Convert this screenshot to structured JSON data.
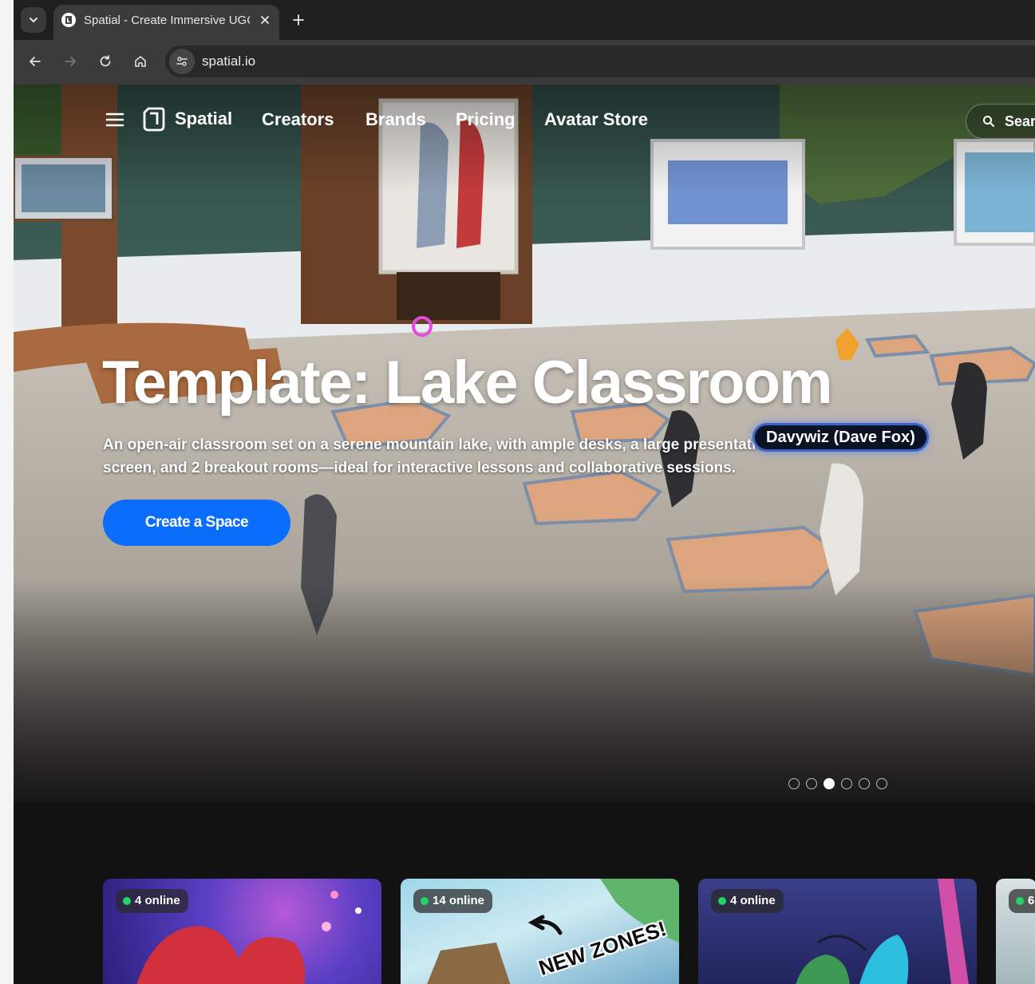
{
  "browser": {
    "tab_title": "Spatial - Create Immersive UGC",
    "url": "spatial.io",
    "colors": {
      "frame": "#1f1f1f",
      "toolbar": "#3b3b3b"
    }
  },
  "nav": {
    "brand": "Spatial",
    "links": [
      "Creators",
      "Brands",
      "Pricing",
      "Avatar Store"
    ],
    "search_placeholder": "Sear"
  },
  "hero": {
    "title": "Template: Lake Classroom",
    "description": "An open-air classroom set on a serene mountain lake, with ample desks, a large presentation screen, and 2 breakout rooms—ideal for interactive lessons and collaborative sessions.",
    "cta_label": "Create a Space",
    "avatar_name_tag": "Davywiz (Dave Fox)",
    "carousel": {
      "total": 6,
      "active_index": 2
    },
    "colors": {
      "cta": "#0a6dfb",
      "online_dot": "#21d46a"
    }
  },
  "cards": [
    {
      "online_label": "4 online"
    },
    {
      "online_label": "14 online",
      "art_text": "NEW ZONES!"
    },
    {
      "online_label": "4 online"
    },
    {
      "online_label": "6"
    }
  ]
}
